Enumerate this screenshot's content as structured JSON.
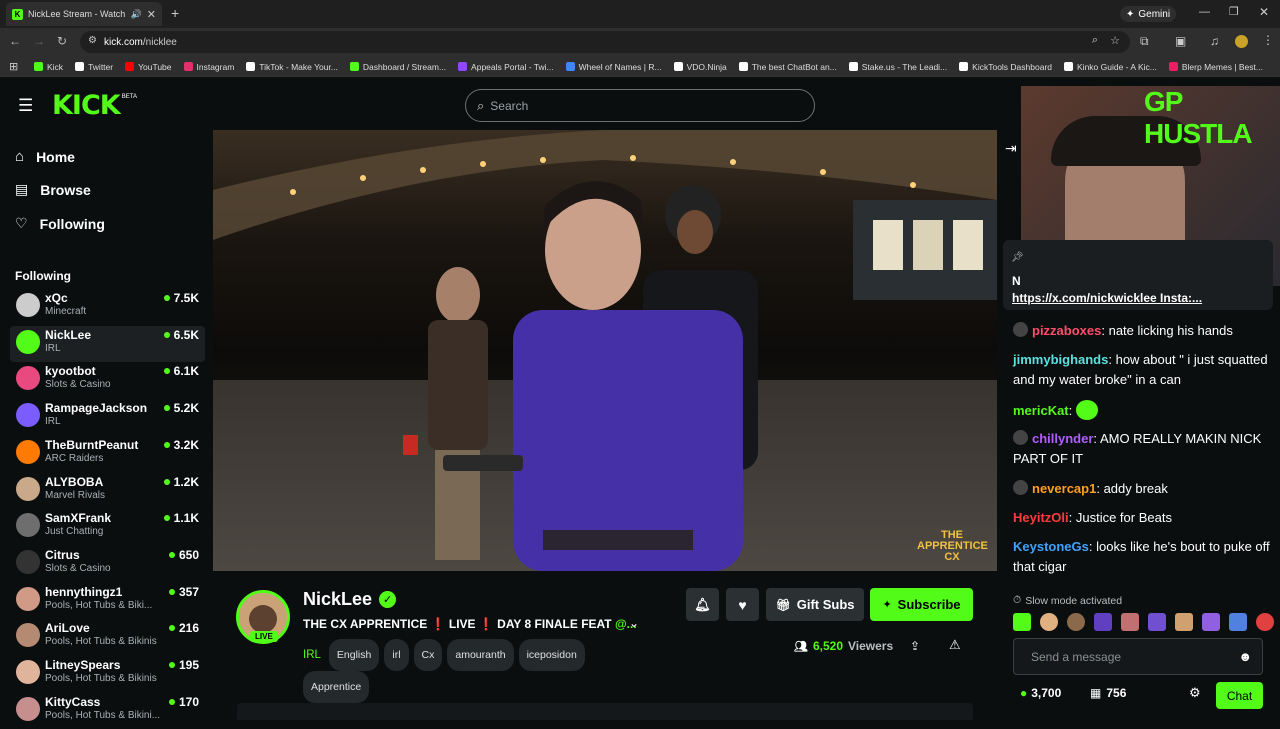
{
  "browser": {
    "tab_title": "NickLee Stream - Watch Liv",
    "gemini_label": "Gemini",
    "url_host": "kick.com",
    "url_path": "/nicklee",
    "bookmarks": [
      {
        "label": "Kick",
        "color": "#53fc18"
      },
      {
        "label": "Twitter",
        "color": "#ffffff"
      },
      {
        "label": "YouTube",
        "color": "#ff0000"
      },
      {
        "label": "Instagram",
        "color": "#e1306c"
      },
      {
        "label": "TikTok - Make Your...",
        "color": "#ffffff"
      },
      {
        "label": "Dashboard / Stream...",
        "color": "#53fc18"
      },
      {
        "label": "Appeals Portal - Twi...",
        "color": "#9146ff"
      },
      {
        "label": "Wheel of Names | R...",
        "color": "#4285f4"
      },
      {
        "label": "VDO.Ninja",
        "color": "#ffffff"
      },
      {
        "label": "The best ChatBot an...",
        "color": "#ffffff"
      },
      {
        "label": "Stake.us - The Leadi...",
        "color": "#ffffff"
      },
      {
        "label": "KickTools Dashboard",
        "color": "#ffffff"
      },
      {
        "label": "Kinko Guide - A Kic...",
        "color": "#ffffff"
      },
      {
        "label": "Blerp Memes | Best...",
        "color": "#e91e63"
      }
    ]
  },
  "kick": {
    "logo": "KICK",
    "beta": "BETA",
    "search_placeholder": "Search",
    "nav": {
      "home": "Home",
      "browse": "Browse",
      "following": "Following"
    },
    "following_heading": "Following",
    "channels": [
      {
        "name": "xQc",
        "category": "Minecraft",
        "viewers": "7.5K",
        "color": "#cccccc"
      },
      {
        "name": "NickLee",
        "category": "IRL",
        "viewers": "6.5K",
        "color": "#53fc18"
      },
      {
        "name": "kyootbot",
        "category": "Slots & Casino",
        "viewers": "6.1K",
        "color": "#e84a7f"
      },
      {
        "name": "RampageJackson",
        "category": "IRL",
        "viewers": "5.2K",
        "color": "#7a5cff"
      },
      {
        "name": "TheBurntPeanut",
        "category": "ARC Raiders",
        "viewers": "3.2K",
        "color": "#ff7a00"
      },
      {
        "name": "ALYBOBA",
        "category": "Marvel Rivals",
        "viewers": "1.2K",
        "color": "#c9a98a"
      },
      {
        "name": "SamXFrank",
        "category": "Just Chatting",
        "viewers": "1.1K",
        "color": "#6e6e6e"
      },
      {
        "name": "Citrus",
        "category": "Slots & Casino",
        "viewers": "650",
        "color": "#333333"
      },
      {
        "name": "hennythingz1",
        "category": "Pools, Hot Tubs & Biki...",
        "viewers": "357",
        "color": "#d19a86"
      },
      {
        "name": "AriLove",
        "category": "Pools, Hot Tubs & Bikinis",
        "viewers": "216",
        "color": "#b58a73"
      },
      {
        "name": "LitneySpears",
        "category": "Pools, Hot Tubs & Bikinis",
        "viewers": "195",
        "color": "#e0b49a"
      },
      {
        "name": "KittyCass",
        "category": "Pools, Hot Tubs & Bikini...",
        "viewers": "170",
        "color": "#c78e8e"
      }
    ],
    "video_watermark": "THE APPRENTICE CX",
    "streamer": {
      "name": "NickLee",
      "live_badge": "LIVE",
      "title_a": "THE CX APPRENTICE",
      "title_b": "LIVE",
      "title_c": "DAY 8 FINALE FEAT",
      "title_d": "@...",
      "category": "IRL",
      "tags": [
        "English",
        "irl",
        "Cx",
        "amouranth",
        "iceposidon",
        "Apprentice"
      ],
      "viewers": "6,520",
      "viewers_label": "Viewers",
      "gift_subs": "Gift Subs",
      "subscribe": "Subscribe"
    },
    "chat": {
      "overlay_text": "GP HUSTLA",
      "pinned_initial": "N",
      "pinned_link": "https://x.com/nickwicklee Insta:...",
      "messages": [
        {
          "user": "pizzaboxes",
          "text": "nate licking his hands",
          "color": "#ff4d6d",
          "badge": true
        },
        {
          "user": "jimmybighands",
          "text": "how about \" i just squatted and my water broke\" in a can",
          "color": "#5ee0e0",
          "badge": false
        },
        {
          "user": "mericKat",
          "text": "",
          "color": "#53fc18",
          "badge": false
        },
        {
          "user": "chillynder",
          "text": "AMO REALLY MAKIN NICK PART OF IT",
          "color": "#b15cff",
          "badge": true
        },
        {
          "user": "nevercap1",
          "text": "addy break",
          "color": "#ff9f1a",
          "badge": true
        },
        {
          "user": "HeyitzOli",
          "text": "Justice for Beats",
          "color": "#ff3b3b",
          "badge": false
        },
        {
          "user": "KeystoneGs",
          "text": "looks like he's bout to puke off that cigar",
          "color": "#3fa2ff",
          "badge": false
        }
      ],
      "slow_mode": "Slow mode activated",
      "send_placeholder": "Send a message",
      "points": "3,700",
      "bits": "756",
      "chat_button": "Chat"
    }
  }
}
